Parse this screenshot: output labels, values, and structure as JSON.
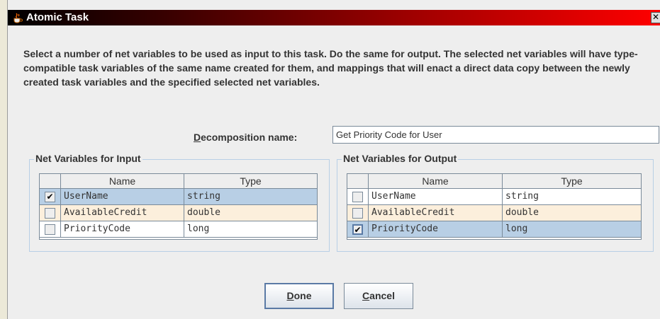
{
  "window": {
    "title": "Atomic Task",
    "close_glyph": "✕",
    "icon": "java-cup-icon"
  },
  "instructions": "Select a number of net variables to be used as input to this task. Do the same for output. The selected net variables will have type-compatible task variables of the same name created for them, and mappings that will enact a direct data copy between the newly created task variables and the specified selected net variables.",
  "decomposition": {
    "label_mnemonic": "D",
    "label_rest": "ecomposition name:",
    "value": "Get Priority Code for User"
  },
  "input_group": {
    "title": "Net Variables for Input",
    "columns": [
      "Name",
      "Type"
    ],
    "rows": [
      {
        "name": "UserName",
        "type": "string",
        "checked": true,
        "check_glyph": "✔"
      },
      {
        "name": "AvailableCredit",
        "type": "double",
        "checked": false,
        "check_glyph": ""
      },
      {
        "name": "PriorityCode",
        "type": "long",
        "checked": false,
        "check_glyph": ""
      }
    ]
  },
  "output_group": {
    "title": "Net Variables for Output",
    "columns": [
      "Name",
      "Type"
    ],
    "rows": [
      {
        "name": "UserName",
        "type": "string",
        "checked": false,
        "check_glyph": ""
      },
      {
        "name": "AvailableCredit",
        "type": "double",
        "checked": false,
        "check_glyph": ""
      },
      {
        "name": "PriorityCode",
        "type": "long",
        "checked": true,
        "check_glyph": "✔"
      }
    ]
  },
  "buttons": {
    "done_mnemonic": "D",
    "done_rest": "one",
    "cancel_mnemonic": "C",
    "cancel_rest": "ancel"
  },
  "colors": {
    "title_gradient_start": "#000000",
    "title_gradient_end": "#ff0000",
    "selected_row": "#b8cfe5",
    "alternate_row": "#fcefdc",
    "background": "#eeeeee"
  }
}
